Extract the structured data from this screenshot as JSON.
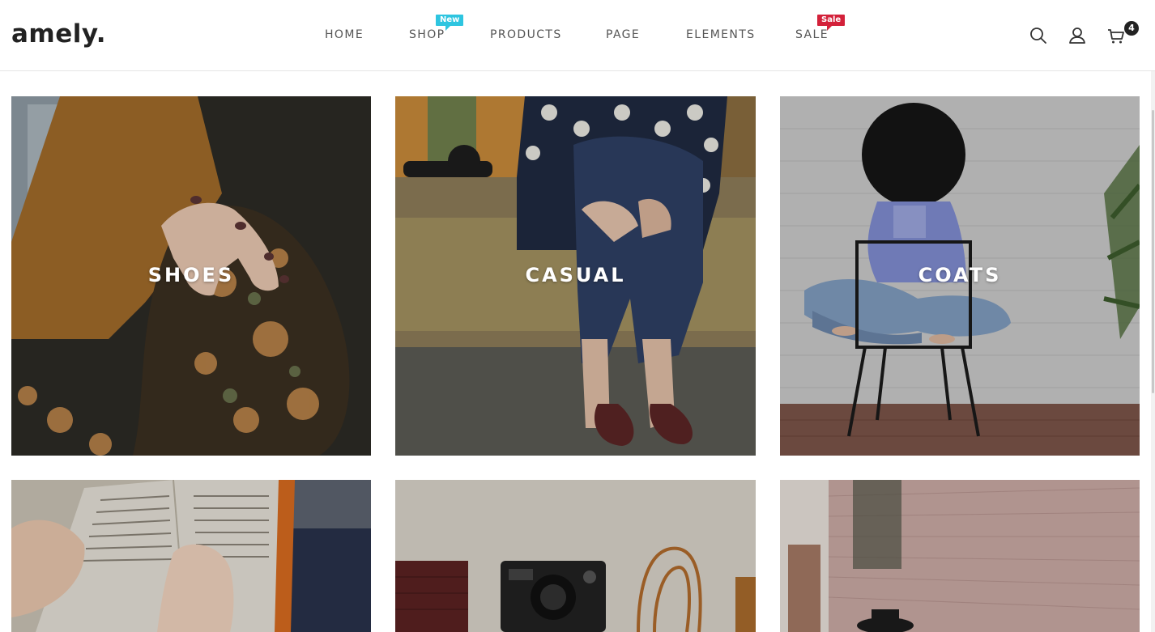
{
  "brand": {
    "logo": "amely."
  },
  "nav": {
    "items": [
      {
        "label": "HOME"
      },
      {
        "label": "SHOP",
        "badge": "New"
      },
      {
        "label": "PRODUCTS"
      },
      {
        "label": "PAGE"
      },
      {
        "label": "ELEMENTS"
      },
      {
        "label": "SALE",
        "badge": "Sale"
      }
    ]
  },
  "header_icons": {
    "search": "search-icon",
    "account": "user-icon",
    "cart": "cart-icon",
    "cart_count": "4"
  },
  "categories": [
    {
      "label": "SHOES"
    },
    {
      "label": "CASUAL"
    },
    {
      "label": "COATS"
    },
    {
      "label": ""
    },
    {
      "label": ""
    },
    {
      "label": ""
    }
  ],
  "colors": {
    "badge_new": "#2ec5e0",
    "badge_sale": "#d3213a",
    "text": "#555555",
    "logo": "#222222"
  }
}
